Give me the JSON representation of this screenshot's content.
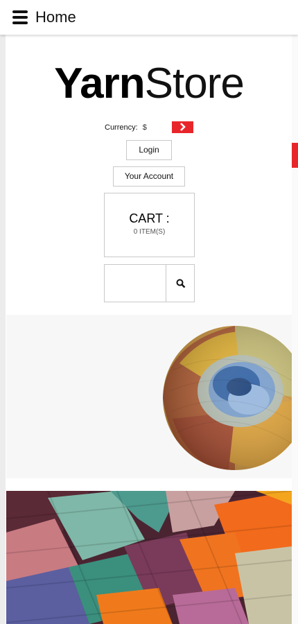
{
  "header": {
    "title": "Home"
  },
  "logo": {
    "part1": "Yarn",
    "part2": "Store"
  },
  "currency": {
    "label": "Currency:",
    "symbol": "$"
  },
  "buttons": {
    "login": "Login",
    "account": "Your Account"
  },
  "cart": {
    "title": "CART :",
    "count": "0 ITEM(S)"
  },
  "search": {
    "placeholder": ""
  },
  "icons": {
    "menu": "menu-icon",
    "currency_next": "chevron-right-icon",
    "search": "search-icon"
  },
  "colors": {
    "accent": "#e8262a",
    "border": "#c8c8c8",
    "text": "#111111"
  }
}
